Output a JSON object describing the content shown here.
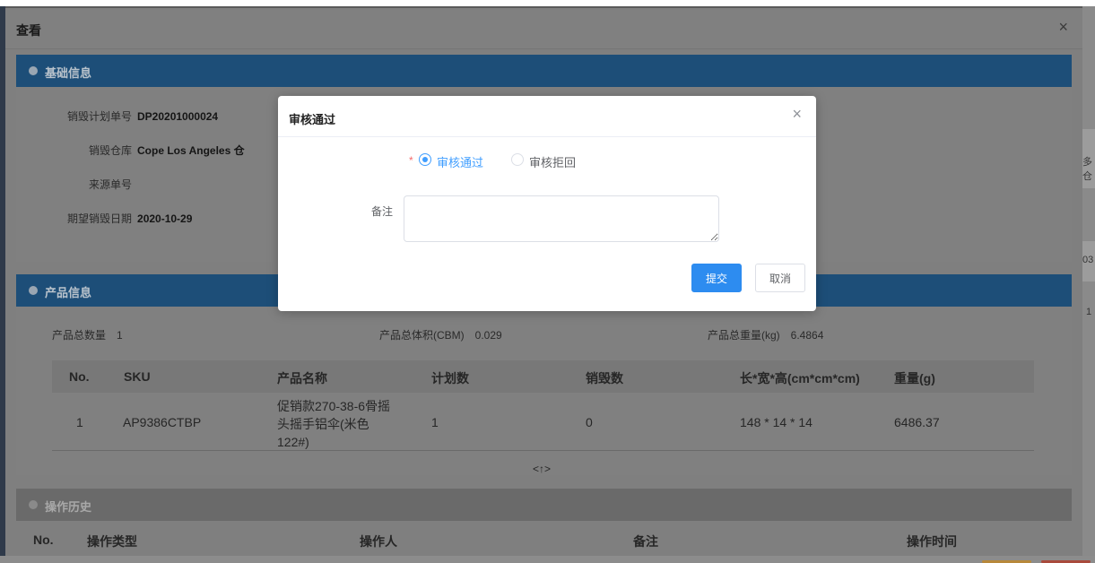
{
  "panel": {
    "title": "查看",
    "close_glyph": "×"
  },
  "basic_section": {
    "title": "基础信息",
    "fields": [
      {
        "label": "销毁计划单号",
        "value": "DP20201000024"
      },
      {
        "label": "销毁仓库",
        "value": "Cope Los Angeles 仓"
      },
      {
        "label": "来源单号",
        "value": ""
      },
      {
        "label": "期望销毁日期",
        "value": "2020-10-29"
      }
    ]
  },
  "product_section": {
    "title": "产品信息",
    "stats": [
      {
        "label": "产品总数量",
        "value": "1"
      },
      {
        "label": "产品总体积(CBM)",
        "value": "0.029"
      },
      {
        "label": "产品总重量(kg)",
        "value": "6.4864"
      }
    ],
    "columns": [
      "No.",
      "SKU",
      "产品名称",
      "计划数",
      "销毁数",
      "长*宽*高(cm*cm*cm)",
      "重量(g)"
    ],
    "rows": [
      {
        "no": "1",
        "sku": "AP9386CTBP",
        "name": "促销款270-38-6骨摇头摇手铝伞(米色 122#)",
        "planned": "1",
        "destroyed": "0",
        "dimensions": "148 * 14 * 14",
        "weight": "6486.37"
      }
    ],
    "expand_glyph": "<↑>"
  },
  "history_section": {
    "title": "操作历史",
    "columns": [
      "No.",
      "操作类型",
      "操作人",
      "备注",
      "操作时间"
    ]
  },
  "dialog": {
    "title": "审核通过",
    "close_glyph": "×",
    "required_mark": "*",
    "options": [
      {
        "label": "审核通过",
        "checked": true
      },
      {
        "label": "审核拒回",
        "checked": false
      }
    ],
    "remark_label": "备注",
    "remark_value": "",
    "submit_label": "提交",
    "cancel_label": "取消"
  },
  "colors": {
    "primary": "#2d8cf0",
    "radio_active": "#409eff",
    "required": "#f56c6c",
    "section_bar": "#3a8fd0"
  },
  "background_fragments": {
    "right_texts": [
      "多仓",
      "03",
      "1"
    ]
  }
}
